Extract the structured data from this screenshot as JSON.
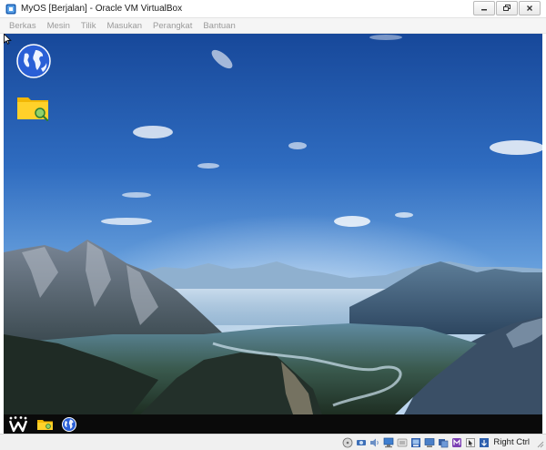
{
  "window": {
    "title": "MyOS [Berjalan] - Oracle VM VirtualBox",
    "controls": [
      "minimize-icon",
      "restore-icon",
      "close-icon"
    ]
  },
  "menubar": {
    "items": [
      {
        "label": "Berkas"
      },
      {
        "label": "Mesin"
      },
      {
        "label": "Tilik"
      },
      {
        "label": "Masukan"
      },
      {
        "label": "Perangkat"
      },
      {
        "label": "Bantuan"
      }
    ]
  },
  "guest": {
    "wallpaper": "mountain-valley-sky",
    "desktop_icons": [
      "globe-internet-icon",
      "file-manager-folder-icon"
    ],
    "taskbar_items": [
      "start-w-icon",
      "file-manager-icon",
      "browser-globe-icon"
    ]
  },
  "statusbar": {
    "device_icons": [
      "hard-disk-icon",
      "optical-drive-icon",
      "audio-icon",
      "network-icon",
      "usb-icon",
      "shared-folders-icon",
      "display-icon",
      "video-capture-icon",
      "cpu-icon",
      "mouse-integration-icon",
      "keyboard-capture-icon"
    ],
    "host_key_label": "Right Ctrl"
  },
  "colors": {
    "sky_top": "#1d4f9e",
    "sky_bottom": "#7fb4e6",
    "taskbar": "#0a0a0a",
    "menu_text": "#9a9a9a"
  }
}
